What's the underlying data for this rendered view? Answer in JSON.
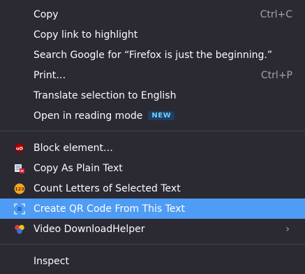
{
  "menu": {
    "copy": {
      "label": "Copy",
      "shortcut": "Ctrl+C"
    },
    "copy_link": {
      "label": "Copy link to highlight"
    },
    "search_google": {
      "label": "Search Google for “Firefox is just the beginning.”"
    },
    "print": {
      "label": "Print…",
      "shortcut": "Ctrl+P"
    },
    "translate": {
      "label": "Translate selection to English"
    },
    "reading_mode": {
      "label": "Open in reading mode",
      "badge": "NEW"
    },
    "block_element": {
      "label": "Block element…",
      "icon": "ublock-origin-icon"
    },
    "copy_plain": {
      "label": "Copy As Plain Text",
      "icon": "copy-plain-text-icon"
    },
    "count_letters": {
      "label": "Count Letters of Selected Text",
      "icon": "count-letters-icon"
    },
    "qr_code": {
      "label": "Create QR Code From This Text",
      "icon": "qr-code-icon"
    },
    "video_dh": {
      "label": "Video DownloadHelper",
      "icon": "video-downloadhelper-icon"
    },
    "inspect": {
      "label": "Inspect"
    }
  },
  "colors": {
    "background": "#2b2a33",
    "highlight": "#4f9cf5",
    "text": "#fbfbfe",
    "shortcut": "#a3a3aa",
    "badge_bg": "#1f3e63",
    "badge_text": "#6fd1ff"
  }
}
